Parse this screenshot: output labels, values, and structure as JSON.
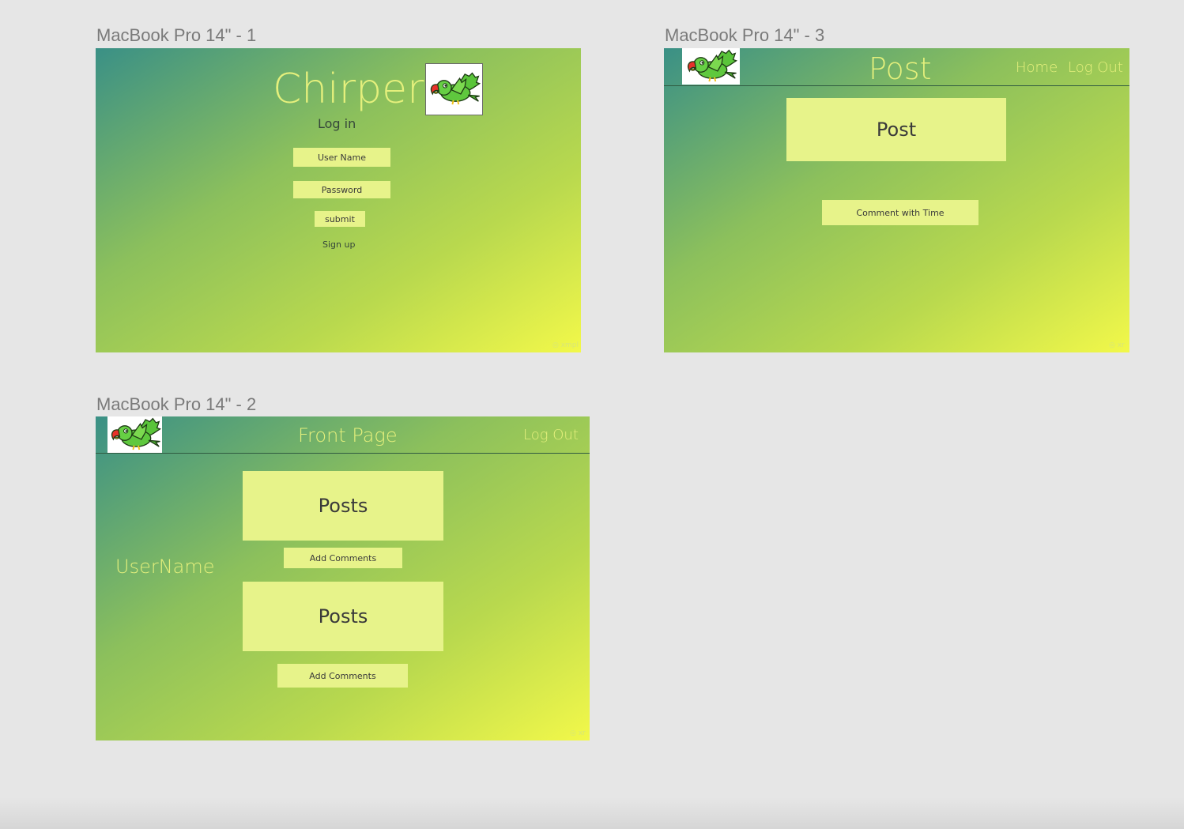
{
  "artboards": {
    "login": {
      "title": "MacBook Pro 14\" - 1",
      "app_name": "Chirper",
      "heading": "Log in",
      "username_placeholder": "User Name",
      "password_placeholder": "Password",
      "submit_label": "submit",
      "signup_label": "Sign up",
      "watermark": "◎ xmpl"
    },
    "post": {
      "title": "MacBook Pro 14\" - 3",
      "page_title": "Post",
      "nav": {
        "home": "Home",
        "logout": "Log Out"
      },
      "post_box": "Post",
      "comment_box": "Comment with Time",
      "watermark": "◎ xr"
    },
    "front": {
      "title": "MacBook Pro 14\" - 2",
      "page_title": "Front Page",
      "nav": {
        "logout": "Log Out"
      },
      "username": "UserName",
      "posts": [
        {
          "label": "Posts",
          "comment_label": "Add Comments"
        },
        {
          "label": "Posts",
          "comment_label": "Add Comments"
        }
      ],
      "watermark": "◎ xr"
    }
  },
  "icons": {
    "logo": "parrot-icon"
  },
  "colors": {
    "canvas": "#e6e6e6",
    "gradient_start": "#3a9086",
    "gradient_end": "#f2f84a",
    "box_fill": "#e7f38a",
    "light_text": "#e5f07c"
  }
}
